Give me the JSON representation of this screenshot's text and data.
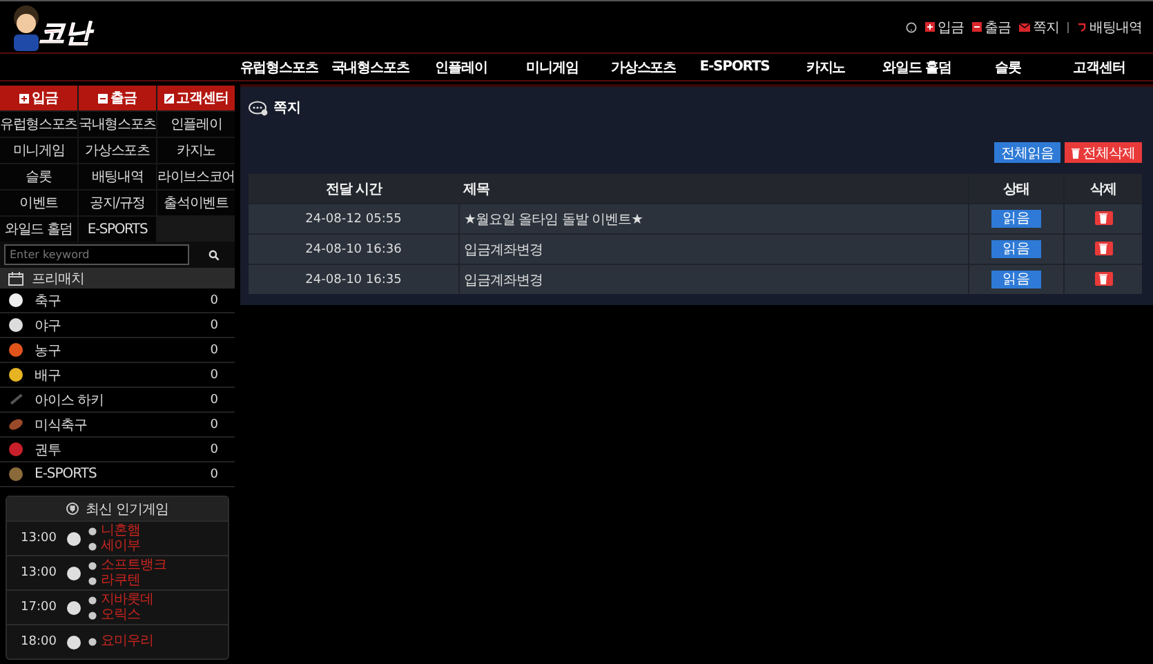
{
  "header": {
    "logo": "코난",
    "top_links": [
      {
        "kind": "deposit",
        "label": "입금"
      },
      {
        "kind": "withdraw",
        "label": "출금"
      },
      {
        "kind": "message",
        "label": "쪽지"
      },
      {
        "kind": "history",
        "label": "배팅내역"
      }
    ]
  },
  "nav": [
    "유럽형스포츠",
    "국내형스포츠",
    "인플레이",
    "미니게임",
    "가상스포츠",
    "E-SPORTS",
    "카지노",
    "와일드 홀덤",
    "슬롯",
    "고객센터"
  ],
  "sidebar": {
    "quick_buttons": [
      {
        "kind": "deposit",
        "label": "입금"
      },
      {
        "kind": "withdraw",
        "label": "출금"
      },
      {
        "kind": "support",
        "label": "고객센터"
      }
    ],
    "menu": [
      "유럽형스포츠",
      "국내형스포츠",
      "인플레이",
      "미니게임",
      "가상스포츠",
      "카지노",
      "슬롯",
      "배팅내역",
      "라이브스코어",
      "이벤트",
      "공지/규정",
      "출석이벤트",
      "와일드 홀덤",
      "E-SPORTS"
    ],
    "search": {
      "placeholder": "Enter keyword"
    },
    "prematch_title": "프리매치",
    "sports": [
      {
        "kind": "soccer",
        "name": "축구",
        "count": "0"
      },
      {
        "kind": "baseball",
        "name": "야구",
        "count": "0"
      },
      {
        "kind": "basketball",
        "name": "농구",
        "count": "0"
      },
      {
        "kind": "volleyball",
        "name": "배구",
        "count": "0"
      },
      {
        "kind": "hockey",
        "name": "아이스 하키",
        "count": "0"
      },
      {
        "kind": "football",
        "name": "미식축구",
        "count": "0"
      },
      {
        "kind": "boxing",
        "name": "권투",
        "count": "0"
      },
      {
        "kind": "esports",
        "name": "E-SPORTS",
        "count": "0"
      }
    ],
    "popular_title": "최신 인기게임",
    "games": [
      {
        "time": "13:00",
        "teams": [
          "니혼햄",
          "세이부"
        ]
      },
      {
        "time": "13:00",
        "teams": [
          "소프트뱅크",
          "라쿠텐"
        ]
      },
      {
        "time": "17:00",
        "teams": [
          "지바롯데",
          "오릭스"
        ]
      },
      {
        "time": "18:00",
        "teams": [
          "요미우리"
        ]
      }
    ]
  },
  "main": {
    "title": "쪽지",
    "buttons": [
      {
        "kind": "read_all",
        "label": "전체읽음"
      },
      {
        "kind": "delete_all",
        "label": "전체삭제"
      }
    ],
    "columns": [
      "전달 시간",
      "제목",
      "상태",
      "삭제"
    ],
    "rows": [
      {
        "time": "24-08-12 05:55",
        "subject": "★월요일 올타임 돌발 이벤트★",
        "status": "읽음"
      },
      {
        "time": "24-08-10 16:36",
        "subject": "입금계좌변경",
        "status": "읽음"
      },
      {
        "time": "24-08-10 16:35",
        "subject": "입금계좌변경",
        "status": "읽음"
      }
    ]
  }
}
